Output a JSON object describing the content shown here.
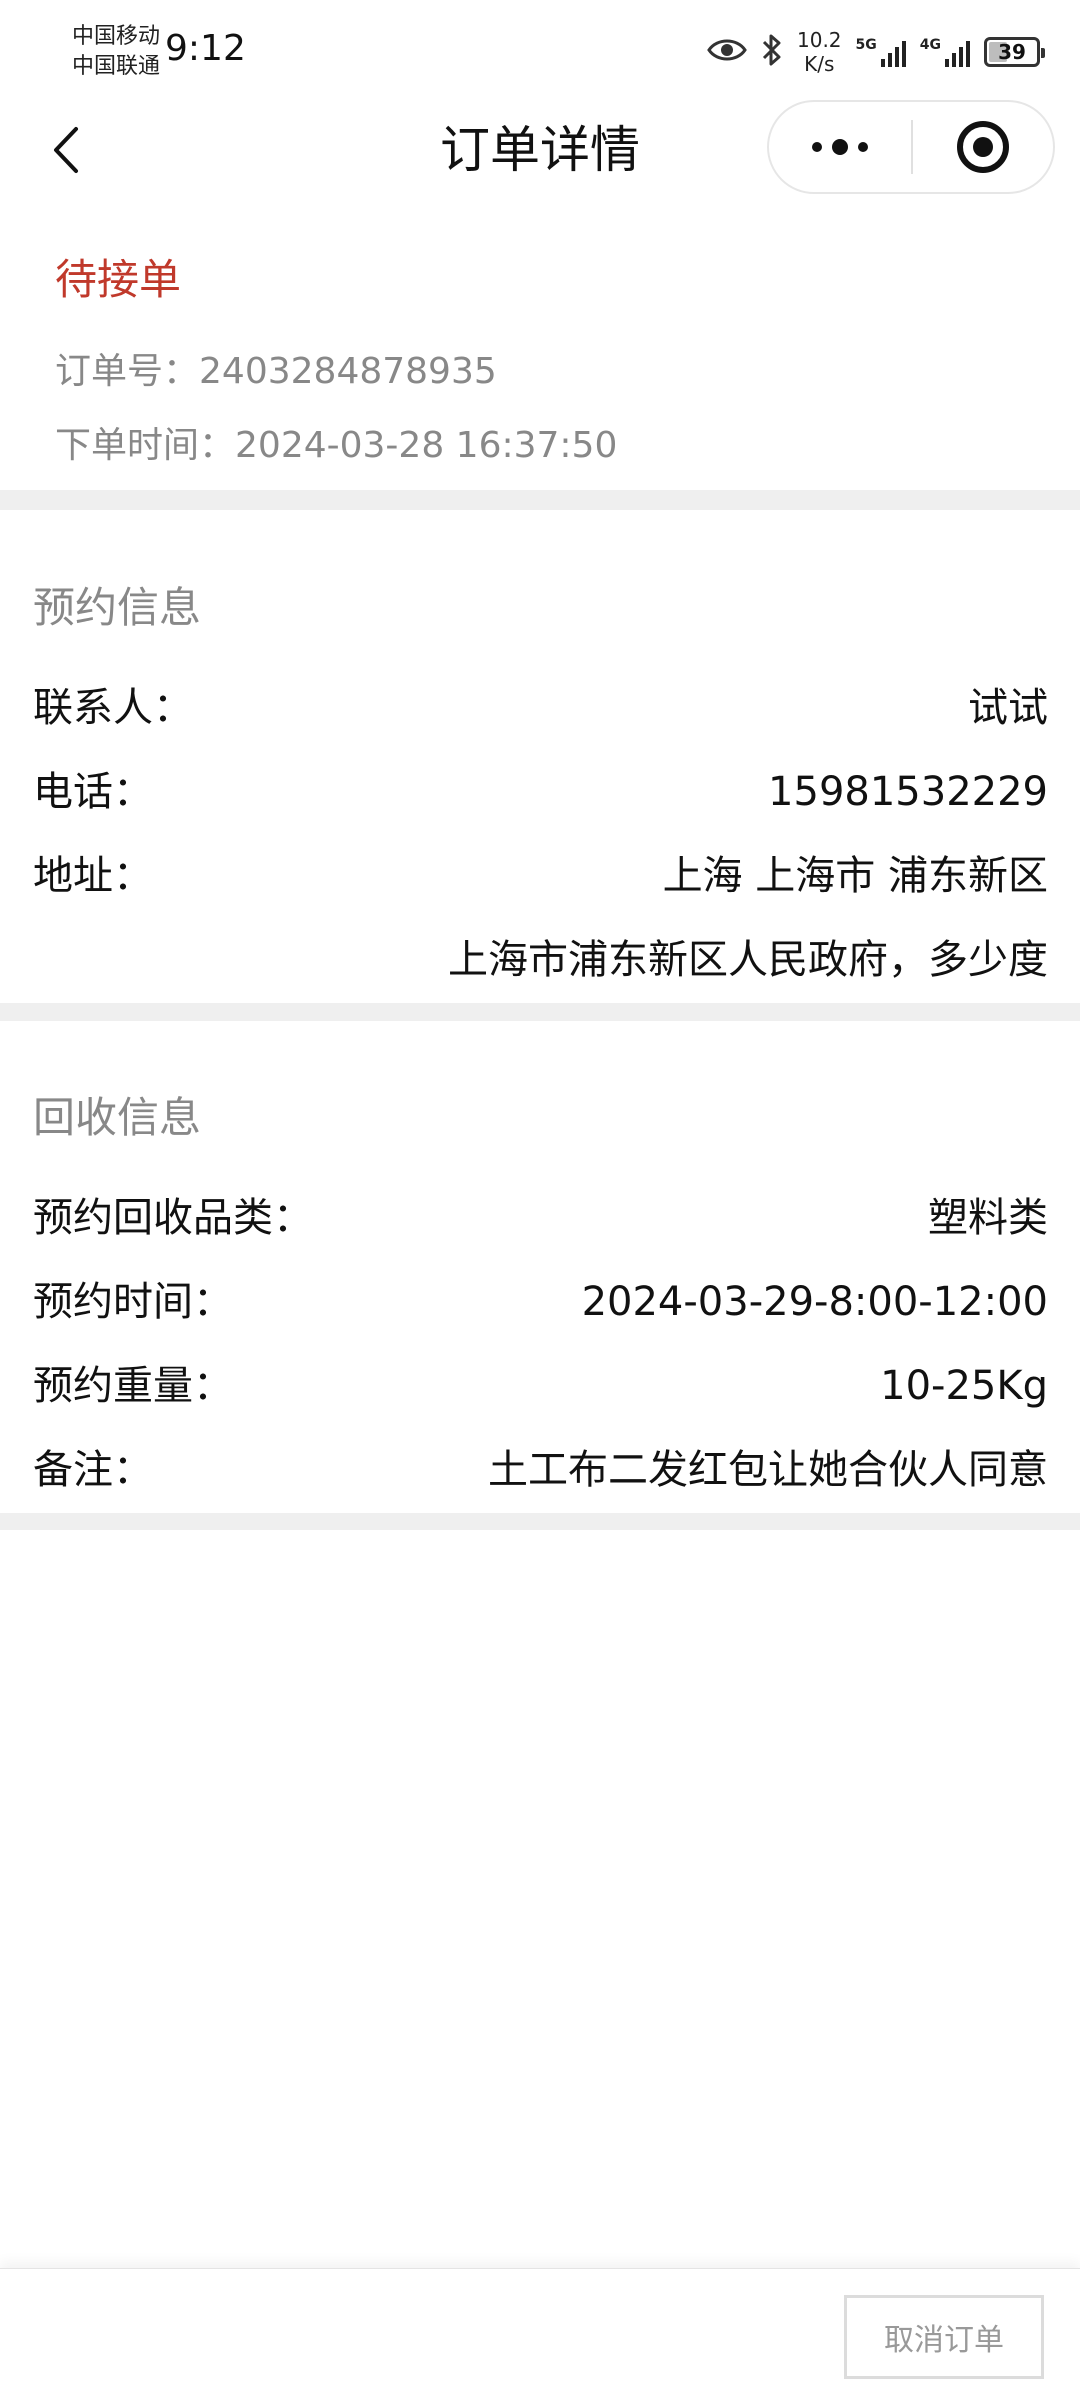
{
  "status_bar": {
    "carrier_1": "中国移动",
    "carrier_2": "中国联通",
    "time": "9:12",
    "net_speed_value": "10.2",
    "net_speed_unit": "K/s",
    "signal_1_label": "5G",
    "signal_2_label": "4G",
    "battery_level": 39,
    "battery_text": "39"
  },
  "nav": {
    "title": "订单详情"
  },
  "order": {
    "status": "待接单",
    "number_label": "订单号：",
    "number": "2403284878935",
    "time_label": "下单时间：",
    "time": "2024-03-28 16:37:50"
  },
  "appointment": {
    "title": "预约信息",
    "contact_label": "联系人：",
    "contact": "试试",
    "phone_label": "电话：",
    "phone": "15981532229",
    "address_label": "地址：",
    "address_region": "上海 上海市 浦东新区",
    "address_detail": "上海市浦东新区人民政府，多少度"
  },
  "recycle": {
    "title": "回收信息",
    "category_label": "预约回收品类：",
    "category": "塑料类",
    "time_label": "预约时间：",
    "time": "2024-03-29-8:00-12:00",
    "weight_label": "预约重量：",
    "weight": "10-25Kg",
    "note_label": "备注：",
    "note": "土工布二发红包让她合伙人同意"
  },
  "actions": {
    "cancel_label": "取消订单"
  },
  "colors": {
    "status_red": "#c0392b",
    "muted_text": "#888888",
    "divider": "#efefef"
  }
}
